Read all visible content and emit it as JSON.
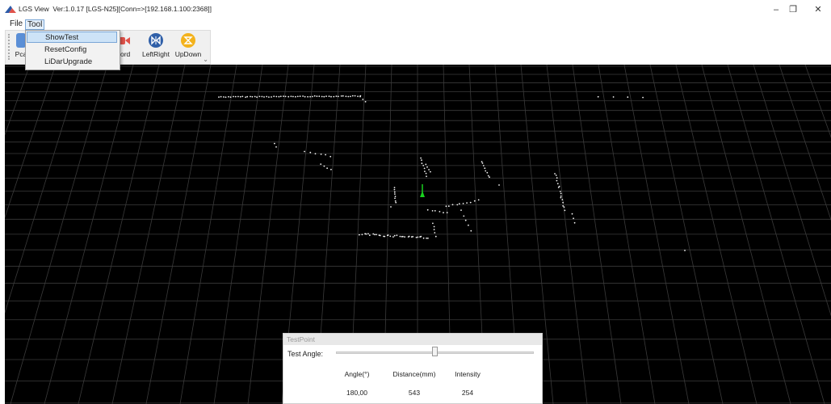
{
  "window": {
    "app_name": "LGS View",
    "version_info": "Ver:1.0.17  [LGS-N25][Conn=>[192.168.1.100:2368]]",
    "minimize_glyph": "–",
    "restore_glyph": "❐",
    "close_glyph": "✕"
  },
  "menu": {
    "file": "File",
    "tool": "Tool",
    "tool_items": [
      "ShowTest",
      "ResetConfig",
      "LiDarUpgrade"
    ],
    "active_item": "ShowTest"
  },
  "toolbar": {
    "buttons": [
      {
        "label": "Pca",
        "icon": "pcap-icon",
        "color": "#5b8fd6"
      },
      {
        "label": "cord",
        "icon": "record-icon",
        "color": "#e0524a"
      },
      {
        "label": "LeftRight",
        "icon": "left-right-flip-icon",
        "color": "#2f5fa8"
      },
      {
        "label": "UpDown",
        "icon": "up-down-flip-icon",
        "color": "#f3b21c"
      }
    ],
    "overflow_glyph": "⌄"
  },
  "viewport": {
    "background": "#000000",
    "grid_color": "#3a3a3a",
    "marker_color": "#19d11f",
    "point_color": "#f2f2f2"
  },
  "test_point": {
    "title": "TestPoint",
    "angle_label": "Test Angle:",
    "slider_value": 0.5,
    "headers": [
      "Angle(°)",
      "Distance(mm)",
      "Intensity"
    ],
    "values": [
      "180,00",
      "543",
      "254"
    ]
  }
}
